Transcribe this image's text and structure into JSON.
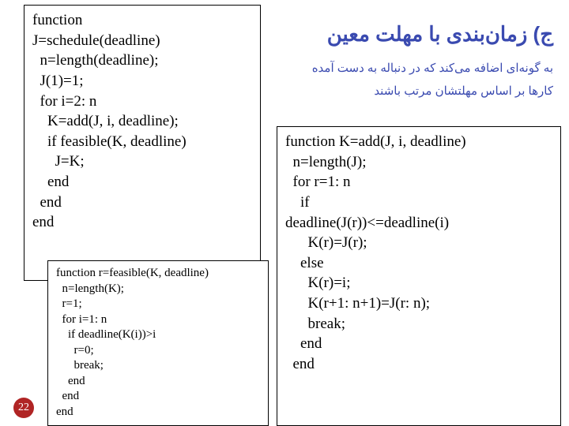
{
  "title_fa": "ج) زمان‌بندی  با مهلت معین",
  "desc_fa": "به گونه‌ای اضافه می‌کند که در دنباله به دست آمده  کارها بر اساس مهلتشان مرتب باشند",
  "pagenum": "22",
  "code1": {
    "l1": "function",
    "l2": "J=schedule(deadline)",
    "l3": "  n=length(deadline);",
    "l4": "  J(1)=1;",
    "l5": "  for i=2: n",
    "l6": "    K=add(J, i, deadline);",
    "l7": "    if feasible(K, deadline)",
    "l8": "      J=K;",
    "l9": "    end",
    "l10": "  end",
    "l11": "end"
  },
  "code2": {
    "l1": "function r=feasible(K, deadline)",
    "l2": "  n=length(K);",
    "l3": "  r=1;",
    "l4": "  for i=1: n",
    "l5": "    if deadline(K(i))>i",
    "l6": "      r=0;",
    "l7": "      break;",
    "l8": "    end",
    "l9": "  end",
    "l10": "end"
  },
  "code3": {
    "l1": "function K=add(J, i, deadline)",
    "l2": "  n=length(J);",
    "l3": "  for r=1: n",
    "l4": "    if",
    "l5": "deadline(J(r))<=deadline(i)",
    "l6": "      K(r)=J(r);",
    "l7": "    else",
    "l8": "      K(r)=i;",
    "l9": "      K(r+1: n+1)=J(r: n);",
    "l10": "      break;",
    "l11": "    end",
    "l12": "  end"
  }
}
